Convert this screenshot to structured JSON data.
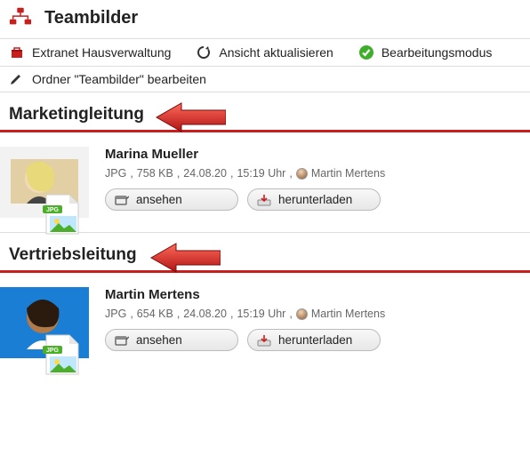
{
  "header": {
    "title": "Teambilder"
  },
  "toolbar": {
    "extranet": "Extranet Hausverwaltung",
    "refresh": "Ansicht aktualisieren",
    "editmode": "Bearbeitungsmodus"
  },
  "subtoolbar": {
    "edit_folder": "Ordner \"Teambilder\" bearbeiten"
  },
  "sections": [
    {
      "heading": "Marketingleitung",
      "entry": {
        "name": "Marina Mueller",
        "format": "JPG",
        "size": "758 KB",
        "date": "24.08.20",
        "time": "15:19 Uhr",
        "uploader": "Martin Mertens",
        "view_label": "ansehen",
        "download_label": "herunterladen"
      }
    },
    {
      "heading": "Vertriebsleitung",
      "entry": {
        "name": "Martin Mertens",
        "format": "JPG",
        "size": "654 KB",
        "date": "24.08.20",
        "time": "15:19 Uhr",
        "uploader": "Martin Mertens",
        "view_label": "ansehen",
        "download_label": "herunterladen"
      }
    }
  ]
}
